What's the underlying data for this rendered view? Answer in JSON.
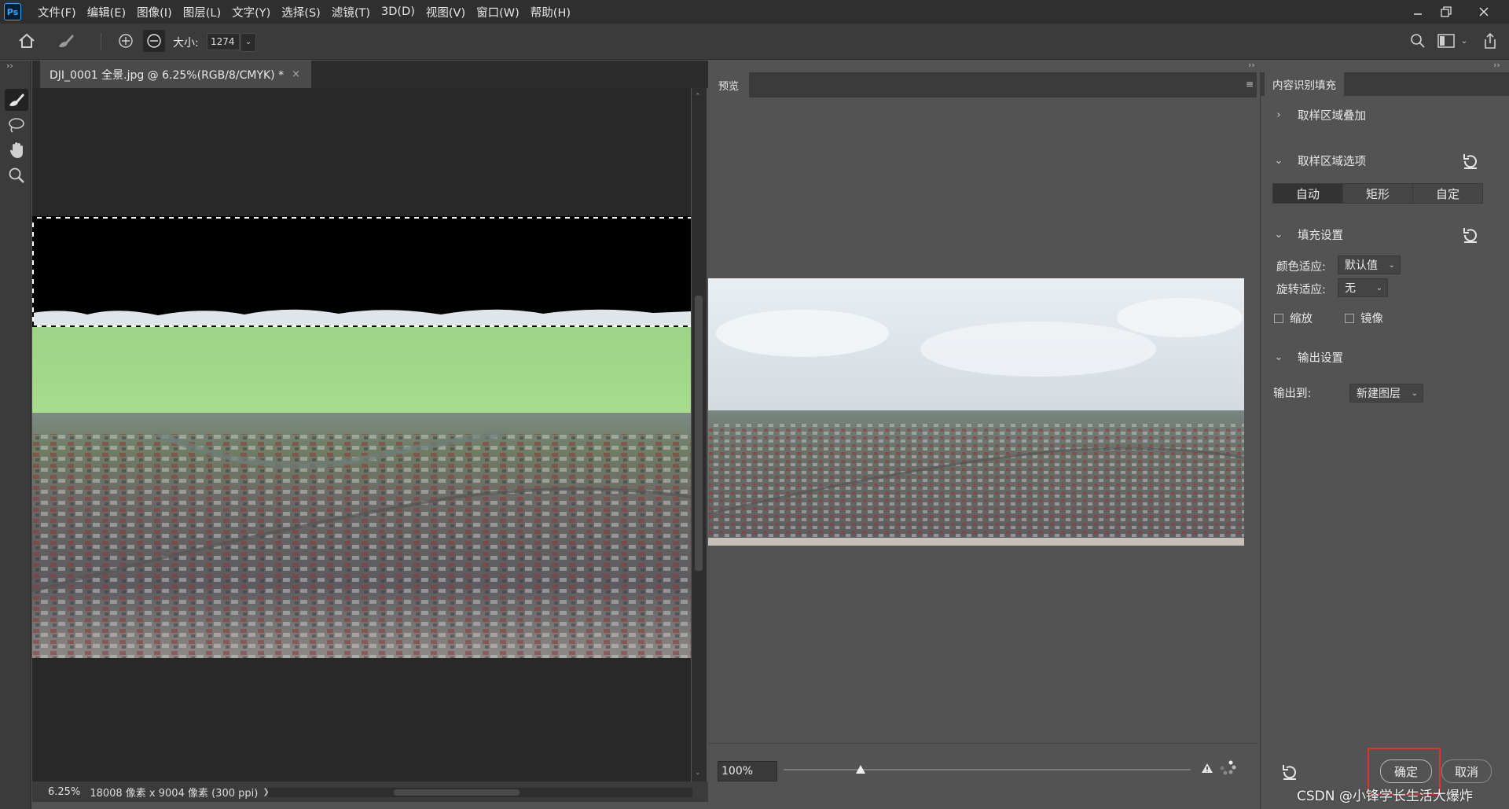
{
  "app": {
    "logo_text": "Ps",
    "menu": [
      "文件(F)",
      "编辑(E)",
      "图像(I)",
      "图层(L)",
      "文字(Y)",
      "选择(S)",
      "滤镜(T)",
      "3D(D)",
      "视图(V)",
      "窗口(W)",
      "帮助(H)"
    ]
  },
  "options_bar": {
    "size_label": "大小:",
    "size_value": "1274"
  },
  "document": {
    "tab_title": "DJI_0001 全景.jpg @ 6.25%(RGB/8/CMYK) *",
    "close_glyph": "×",
    "status_zoom": "6.25%",
    "status_info": "18008 像素 x 9004 像素 (300 ppi)",
    "status_arrow": "❯"
  },
  "preview": {
    "tab_label": "预览",
    "zoom_value": "100%",
    "zoom_slider_fraction": 0.19
  },
  "panel": {
    "tab_label": "内容识别填充",
    "sampling_overlay": "取样区域叠加",
    "sampling_options": "取样区域选项",
    "sampling_modes": [
      "自动",
      "矩形",
      "自定"
    ],
    "sampling_active": 0,
    "fill_settings": "填充设置",
    "color_adapt_label": "颜色适应:",
    "color_adapt_value": "默认值",
    "rotation_adapt_label": "旋转适应:",
    "rotation_adapt_value": "无",
    "scale_label": "缩放",
    "mirror_label": "镜像",
    "output_settings": "输出设置",
    "output_to_label": "输出到:",
    "output_to_value": "新建图层",
    "ok_label": "确定",
    "cancel_label": "取消"
  },
  "watermark": "CSDN @小锋学长生活大爆炸",
  "colors": {
    "selection_fill": "#a4d98a",
    "highlight_box": "#e03030"
  }
}
